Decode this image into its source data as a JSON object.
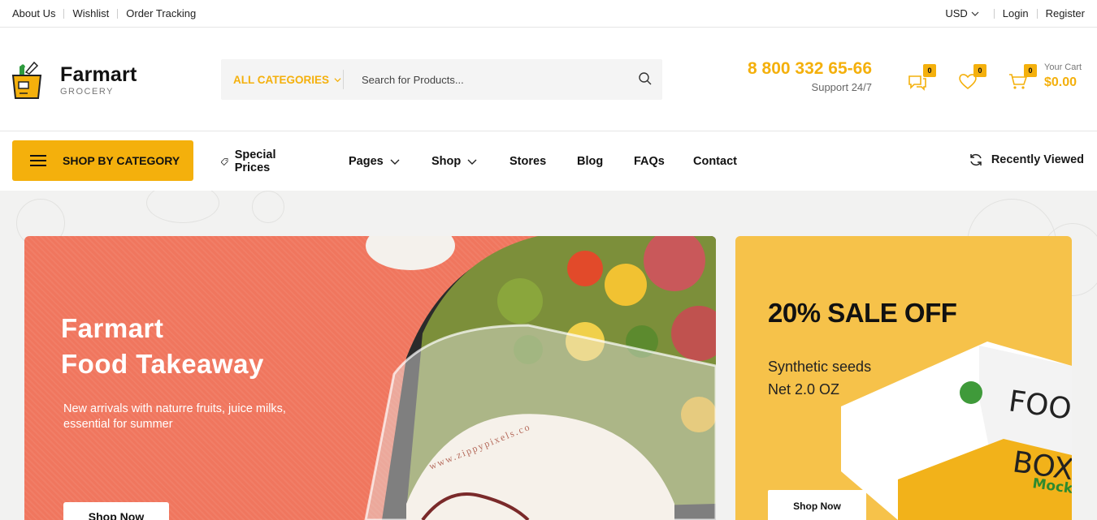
{
  "topbar": {
    "links": [
      "About Us",
      "Wishlist",
      "Order Tracking"
    ],
    "currency": "USD",
    "login": "Login",
    "register": "Register"
  },
  "brand": {
    "name": "Farmart",
    "tagline": "GROCERY"
  },
  "search": {
    "category": "ALL CATEGORIES",
    "placeholder": "Search for Products..."
  },
  "support": {
    "phone": "8 800 332 65-66",
    "label": "Support 24/7"
  },
  "header_icons": {
    "compare_count": "0",
    "wishlist_count": "0",
    "cart_count": "0"
  },
  "cart": {
    "label": "Your Cart",
    "total": "$0.00"
  },
  "nav": {
    "shop_by_category": "SHOP BY CATEGORY",
    "items": [
      "Special Prices",
      "Pages",
      "Shop",
      "Stores",
      "Blog",
      "FAQs",
      "Contact"
    ],
    "recently_viewed": "Recently Viewed"
  },
  "hero": {
    "title_line1": "Farmart",
    "title_line2": "Food Takeaway",
    "subtitle": "New arrivals with naturre fruits, juice milks, essential for summer",
    "button": "Shop Now",
    "package_text": "www.zippypixels.co"
  },
  "promo": {
    "title": "20% SALE OFF",
    "line1": "Synthetic seeds",
    "line2": "Net 2.0 OZ",
    "button": "Shop Now",
    "box_text": [
      "FOOD",
      "BOX",
      "Mock"
    ]
  },
  "colors": {
    "accent": "#f4b00c",
    "hero_bg": "#f0765e",
    "promo_bg": "#f6c24a"
  }
}
